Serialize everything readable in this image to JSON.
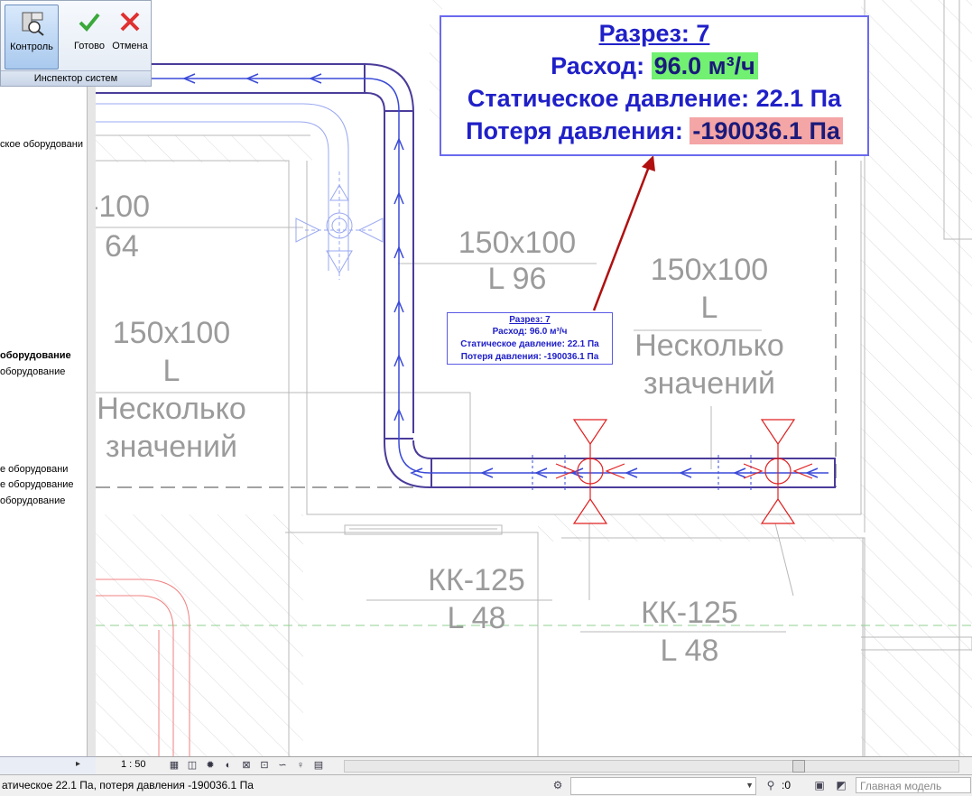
{
  "ribbon": {
    "control_label": "Контроль",
    "done_label": "Готово",
    "cancel_label": "Отмена",
    "panel_title": "Инспектор систем"
  },
  "browser": {
    "items": [
      "ское оборудовани",
      "оборудование",
      "оборудование",
      "е оборудовани",
      "е оборудование",
      "оборудование"
    ]
  },
  "drawing": {
    "tag1_a": "-100",
    "tag1_b": "64",
    "tag2_a": "150x100",
    "tag2_b": "L 96",
    "tag3_a": "150x100",
    "tag3_b": "L",
    "tag3_c": "Несколько",
    "tag3_d": "значений",
    "tag4_a": "150x100",
    "tag4_b": "L",
    "tag4_c": "Несколько",
    "tag4_d": "значений",
    "tag5_a": "КК-125",
    "tag5_b": "L 48",
    "tag6_a": "КК-125",
    "tag6_b": "L 48"
  },
  "tooltip_large": {
    "title": "Разрез: 7",
    "flow_label": "Расход:",
    "flow_value": "96.0 м³/ч",
    "static_pressure": "Статическое давление: 22.1 Па",
    "loss_label": "Потеря давления:",
    "loss_value": "-190036.1 Па"
  },
  "tooltip_small": {
    "title": "Разрез: 7",
    "flow": "Расход: 96.0 м³/ч",
    "static_pressure": "Статическое давление: 22.1 Па",
    "loss": "Потеря давления: -190036.1 Па"
  },
  "view_bar": {
    "scale": "1 : 50"
  },
  "statusbar": {
    "message": "атическое 22.1 Па, потеря давления -190036.1 Па",
    "filter_count": ":0",
    "model": "Главная модель"
  },
  "colors": {
    "duct_outline": "#4a3c9a",
    "flow_arrows": "#3a4ad8",
    "damper": "#e02020",
    "tooltip_border": "#6a6aee",
    "flow_highlight": "#72f072",
    "loss_highlight": "#f4a5a5",
    "leader_arrow": "#b01010"
  },
  "icons": [
    "check-icon",
    "cross-icon",
    "system-inspector-icon"
  ]
}
